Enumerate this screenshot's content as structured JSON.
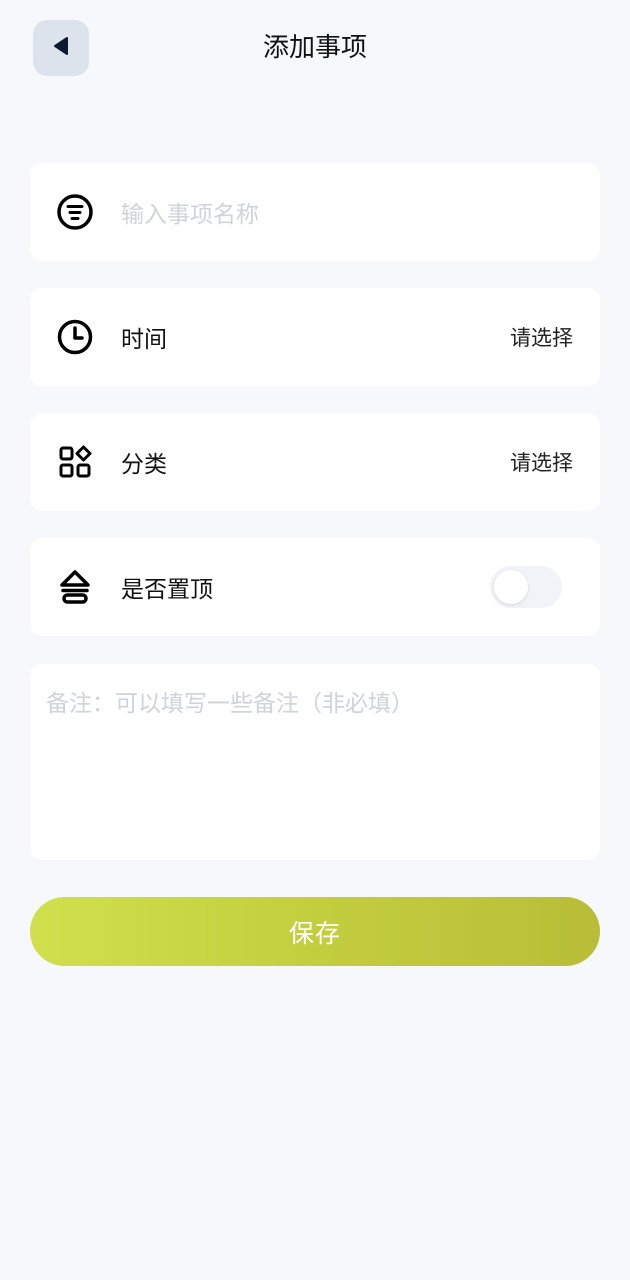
{
  "header": {
    "title": "添加事项",
    "back_icon": "back-triangle-icon"
  },
  "form": {
    "name": {
      "icon": "list-circle-icon",
      "placeholder": "输入事项名称",
      "value": ""
    },
    "time": {
      "icon": "clock-icon",
      "label": "时间",
      "value": "请选择"
    },
    "category": {
      "icon": "grid-category-icon",
      "label": "分类",
      "value": "请选择"
    },
    "pin": {
      "icon": "pin-top-icon",
      "label": "是否置顶",
      "enabled": false
    },
    "note": {
      "placeholder": "备注：可以填写一些备注（非必填）",
      "value": ""
    }
  },
  "actions": {
    "save_label": "保存"
  },
  "colors": {
    "background": "#f6f8fc",
    "card": "#ffffff",
    "accent_start": "#d0e04d",
    "accent_end": "#b9bd38",
    "back_button_bg": "#dde3ec",
    "placeholder": "#cfd3da"
  }
}
